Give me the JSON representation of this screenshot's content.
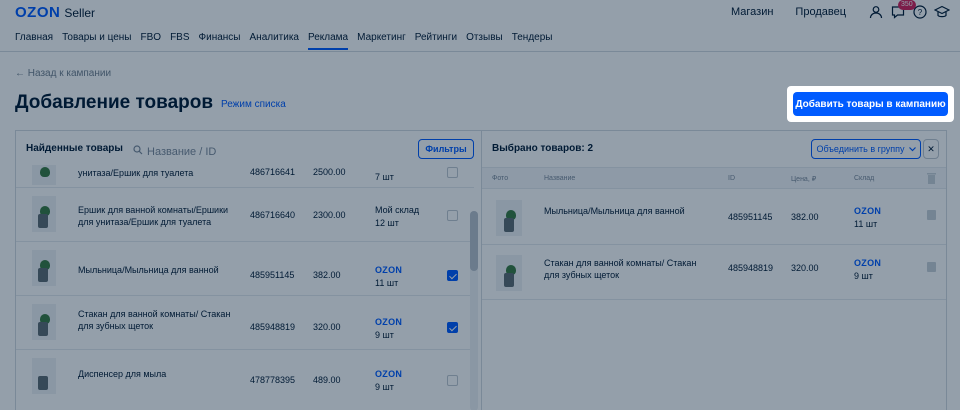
{
  "header": {
    "brand": "OZON",
    "seller": "Seller",
    "links": [
      "Магазин",
      "Продавец"
    ],
    "notifications_badge": "350",
    "icons": [
      "user-icon",
      "chat-icon",
      "help-icon",
      "education-icon"
    ]
  },
  "nav": {
    "items": [
      "Главная",
      "Товары и цены",
      "FBO",
      "FBS",
      "Финансы",
      "Аналитика",
      "Реклама",
      "Маркетинг",
      "Рейтинги",
      "Отзывы",
      "Тендеры"
    ],
    "active": "Реклама"
  },
  "page": {
    "back_link": "← Назад к кампании",
    "title": "Добавление товаров",
    "mode_link": "Режим списка",
    "add_button": "Добавить товары в кампанию"
  },
  "left_panel": {
    "title": "Найденные товары",
    "search_placeholder": "Название / ID",
    "filters_button": "Фильтры",
    "rows": [
      {
        "name": "унитаза/Ершик для туалета",
        "id": "486716641",
        "price": "2500.00",
        "warehouse": "",
        "stock": "7 шт",
        "checked": false
      },
      {
        "name": "Ершик для ванной комнаты/Ершики для унитаза/Ершик для туалета",
        "id": "486716640",
        "price": "2300.00",
        "warehouse": "Мой склад",
        "stock": "12 шт",
        "checked": false
      },
      {
        "name": "Мыльница/Мыльница для ванной",
        "id": "485951145",
        "price": "382.00",
        "warehouse": "OZON",
        "stock": "11 шт",
        "checked": true
      },
      {
        "name": "Стакан для ванной комнаты/ Стакан для зубных щеток",
        "id": "485948819",
        "price": "320.00",
        "warehouse": "OZON",
        "stock": "9 шт",
        "checked": true
      },
      {
        "name": "Диспенсер для мыла",
        "id": "478778395",
        "price": "489.00",
        "warehouse": "OZON",
        "stock": "9 шт",
        "checked": false
      }
    ]
  },
  "right_panel": {
    "title": "Выбрано товаров: 2",
    "merge_button": "Объединить в группу",
    "close_button": "✕",
    "columns": {
      "photo": "Фото",
      "name": "Название",
      "id": "ID",
      "price": "Цена, ₽",
      "warehouse": "Склад"
    },
    "rows": [
      {
        "name": "Мыльница/Мыльница для ванной",
        "id": "485951145",
        "price": "382.00",
        "warehouse": "OZON",
        "stock": "11 шт"
      },
      {
        "name": "Стакан для ванной комнаты/ Стакан для зубных щеток",
        "id": "485948819",
        "price": "320.00",
        "warehouse": "OZON",
        "stock": "9 шт"
      }
    ]
  },
  "colors": {
    "accent": "#005bff",
    "overlay": "rgba(0,26,52,0.42)",
    "badge": "#d6205a"
  }
}
